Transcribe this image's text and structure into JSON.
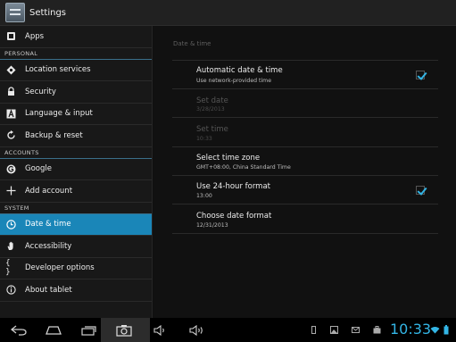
{
  "app": {
    "title": "Settings"
  },
  "sidebar": {
    "items": [
      {
        "type": "item",
        "icon": "apps-icon",
        "label": "Apps"
      },
      {
        "type": "header",
        "label": "PERSONAL"
      },
      {
        "type": "item",
        "icon": "location-icon",
        "label": "Location services"
      },
      {
        "type": "item",
        "icon": "lock-icon",
        "label": "Security"
      },
      {
        "type": "item",
        "icon": "language-icon",
        "label": "Language & input"
      },
      {
        "type": "item",
        "icon": "backup-icon",
        "label": "Backup & reset"
      },
      {
        "type": "header",
        "label": "ACCOUNTS"
      },
      {
        "type": "item",
        "icon": "google-icon",
        "label": "Google"
      },
      {
        "type": "item",
        "icon": "add-icon",
        "label": "Add account"
      },
      {
        "type": "header",
        "label": "SYSTEM"
      },
      {
        "type": "item",
        "icon": "clock-icon",
        "label": "Date & time",
        "selected": true
      },
      {
        "type": "item",
        "icon": "hand-icon",
        "label": "Accessibility"
      },
      {
        "type": "item",
        "icon": "braces-icon",
        "label": "Developer options"
      },
      {
        "type": "item",
        "icon": "info-icon",
        "label": "About tablet"
      }
    ]
  },
  "content": {
    "section_title": "Date & time",
    "settings": [
      {
        "name": "automatic-date-time",
        "title": "Automatic date & time",
        "summary": "Use network-provided time",
        "checkbox": true,
        "checked": true,
        "enabled": true
      },
      {
        "name": "set-date",
        "title": "Set date",
        "summary": "3/28/2013",
        "checkbox": false,
        "enabled": false
      },
      {
        "name": "set-time",
        "title": "Set time",
        "summary": "10:33",
        "checkbox": false,
        "enabled": false
      },
      {
        "name": "select-time-zone",
        "title": "Select time zone",
        "summary": "GMT+08:00, China Standard Time",
        "checkbox": false,
        "enabled": true
      },
      {
        "name": "use-24-hour-format",
        "title": "Use 24-hour format",
        "summary": "13:00",
        "checkbox": true,
        "checked": true,
        "enabled": true
      },
      {
        "name": "choose-date-format",
        "title": "Choose date format",
        "summary": "12/31/2013",
        "checkbox": false,
        "enabled": true
      }
    ]
  },
  "systembar": {
    "clock": "10:33",
    "accent": "#33b5e5"
  }
}
